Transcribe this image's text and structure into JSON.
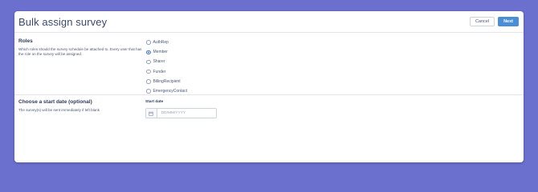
{
  "header": {
    "title": "Bulk assign survey",
    "cancel_label": "Cancel",
    "next_label": "Next"
  },
  "roles": {
    "title": "Roles",
    "description": "Which roles should the survey schedule be attached to. Every user that has the role on the survey will be assigned.",
    "options": [
      {
        "label": "AuthRep",
        "checked": false
      },
      {
        "label": "Member",
        "checked": true
      },
      {
        "label": "Sharer",
        "checked": false
      },
      {
        "label": "Funder",
        "checked": false
      },
      {
        "label": "BillingRecipient",
        "checked": false
      },
      {
        "label": "EmergencyContact",
        "checked": false
      }
    ]
  },
  "start_date": {
    "title": "Choose a start date (optional)",
    "description": "The survey(s) will be sent immediately if left blank",
    "field_label": "Start date",
    "placeholder": "DD/MM/YYYY",
    "value": ""
  },
  "colors": {
    "background": "#6b70cf",
    "accent": "#4a8fd6",
    "text": "#3d4a6b"
  }
}
